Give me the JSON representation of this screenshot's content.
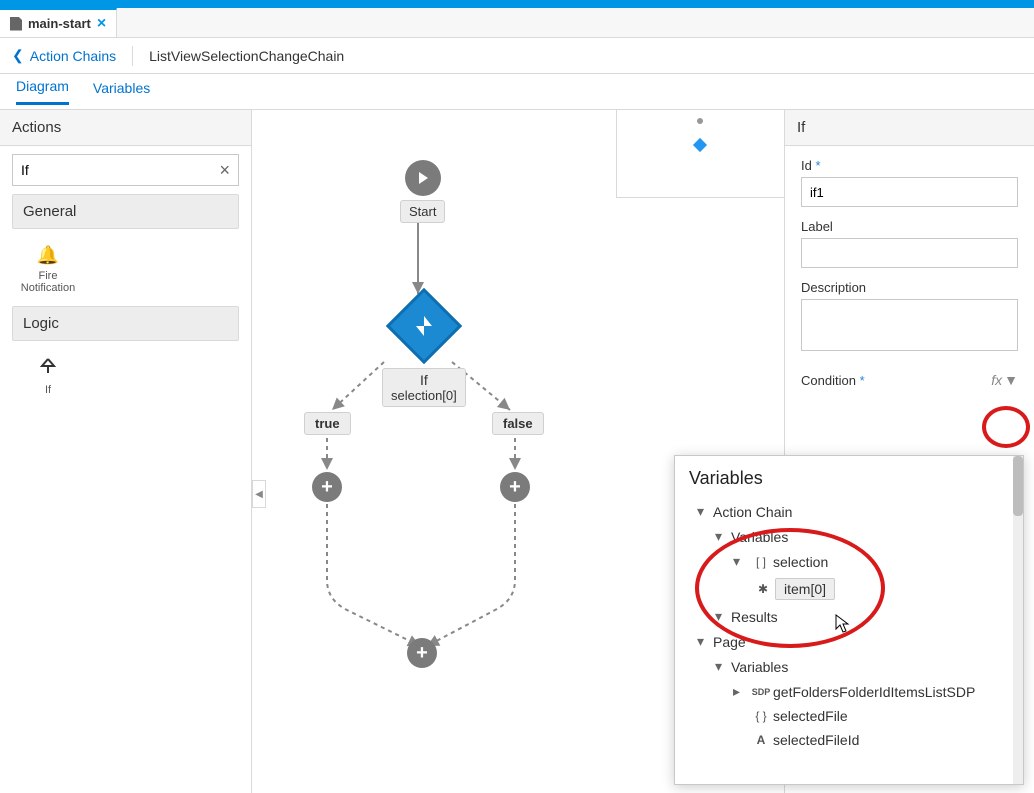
{
  "tab": {
    "filename": "main-start"
  },
  "breadcrumb": {
    "back": "Action Chains",
    "current": "ListViewSelectionChangeChain"
  },
  "subtabs": {
    "diagram": "Diagram",
    "variables": "Variables"
  },
  "actions_panel": {
    "title": "Actions",
    "search_value": "If",
    "groups": {
      "general": {
        "label": "General",
        "fire_notification": "Fire Notification"
      },
      "logic": {
        "label": "Logic",
        "if": "If"
      }
    }
  },
  "canvas": {
    "start": "Start",
    "if_node": {
      "title": "If",
      "subtitle": "selection[0]"
    },
    "branch_true": "true",
    "branch_false": "false"
  },
  "props": {
    "header": "If",
    "id_label": "Id",
    "id_value": "if1",
    "label_label": "Label",
    "label_value": "",
    "desc_label": "Description",
    "desc_value": "",
    "cond_label": "Condition",
    "fx": "fx"
  },
  "var_popup": {
    "title": "Variables",
    "nodes": {
      "action_chain": "Action Chain",
      "variables1": "Variables",
      "selection": "selection",
      "item0": "item[0]",
      "results": "Results",
      "page": "Page",
      "variables2": "Variables",
      "sdp": "getFoldersFolderIdItemsListSDP",
      "selectedFile": "selectedFile",
      "selectedFileId": "selectedFileId"
    }
  }
}
